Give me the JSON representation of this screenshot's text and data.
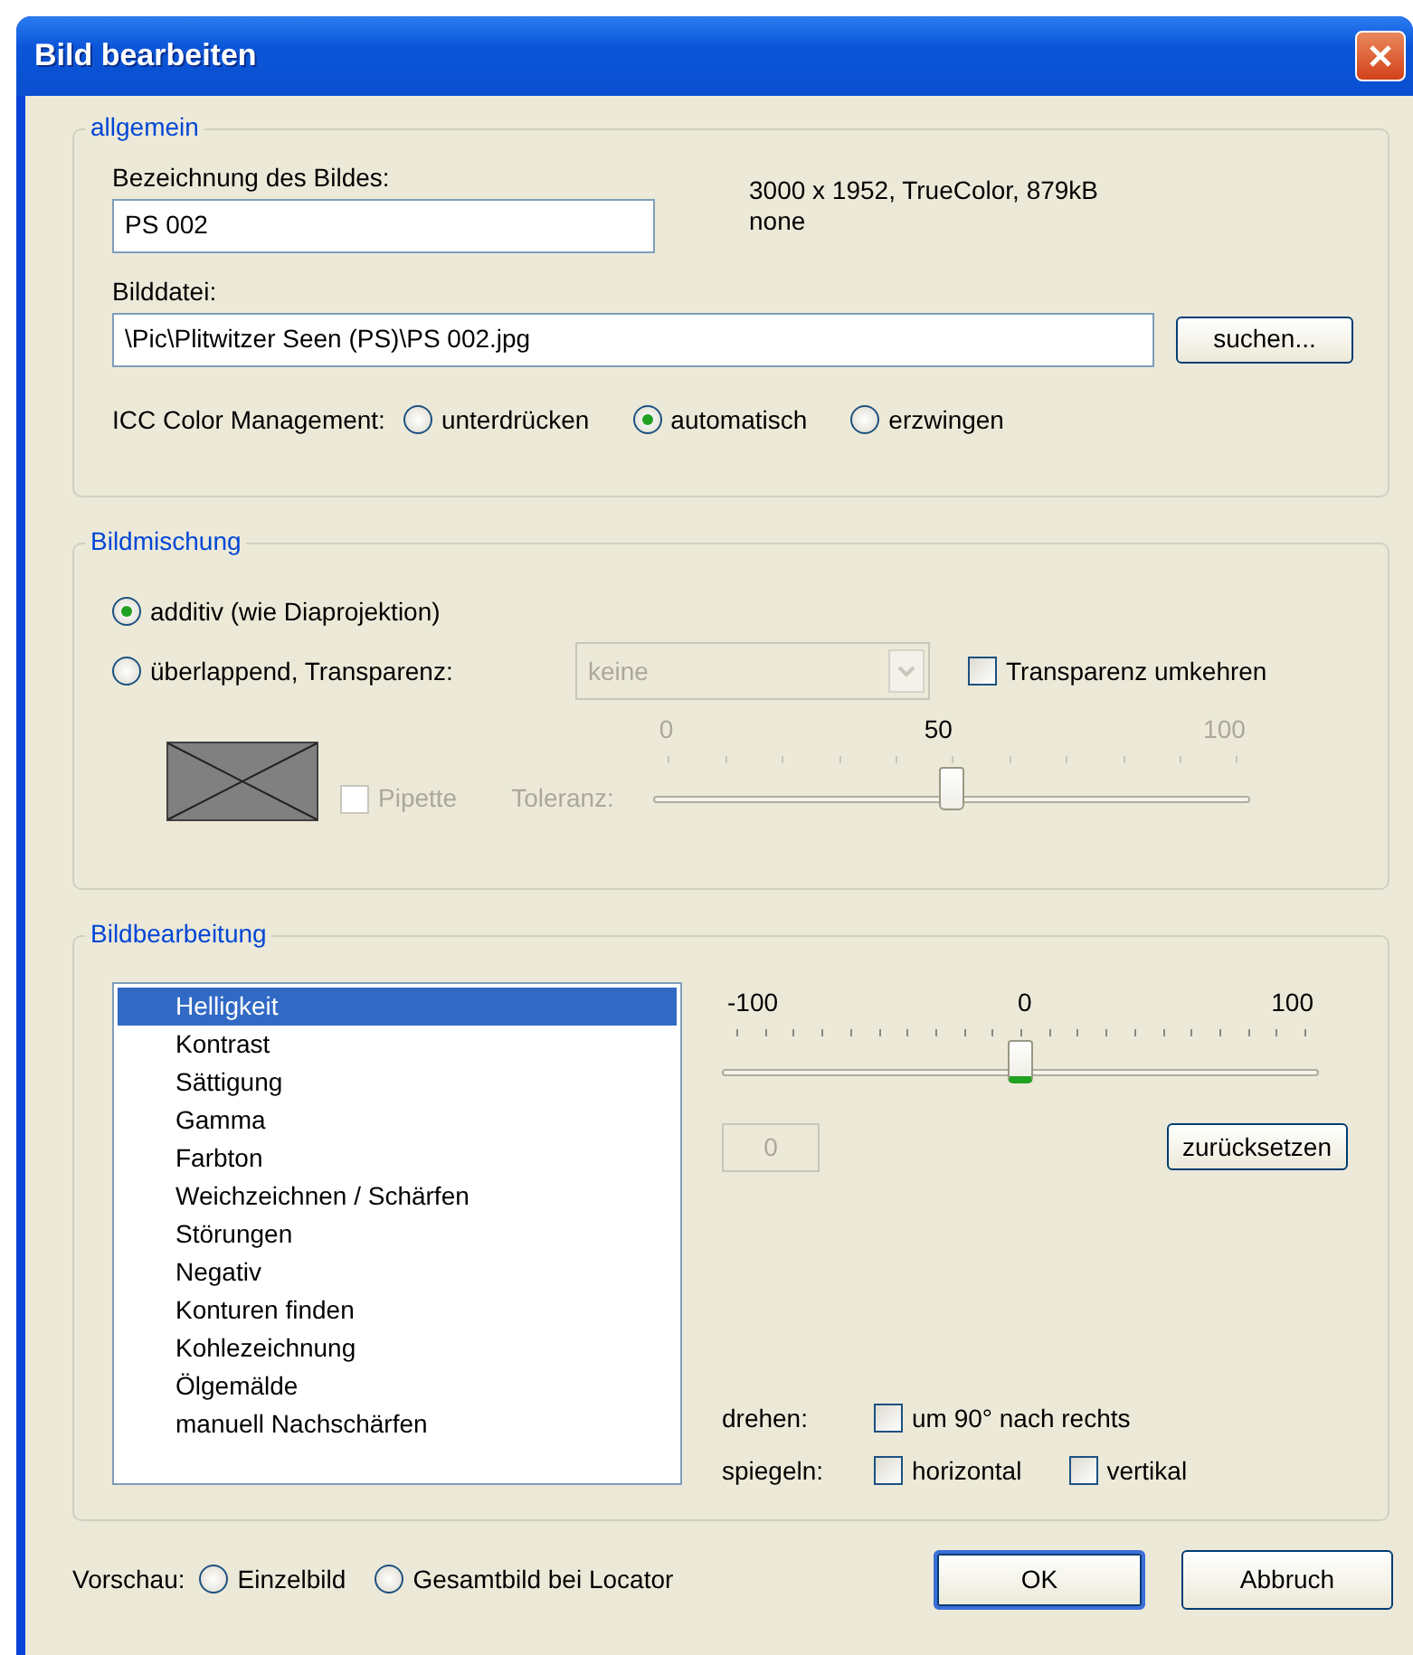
{
  "window": {
    "title": "Bild bearbeiten"
  },
  "general": {
    "legend": "allgemein",
    "name_label": "Bezeichnung des Bildes:",
    "name_value": "PS 002",
    "info": [
      "3000 x 1952, TrueColor, 879kB",
      "none"
    ],
    "file_label": "Bilddatei:",
    "file_value": "\\Pic\\Plitwitzer Seen (PS)\\PS 002.jpg",
    "browse_button": "suchen...",
    "icc_label": "ICC Color Management:",
    "icc_options": [
      {
        "label": "unterdrücken",
        "selected": false
      },
      {
        "label": "automatisch",
        "selected": true
      },
      {
        "label": "erzwingen",
        "selected": false
      }
    ]
  },
  "blending": {
    "legend": "Bildmischung",
    "modes": [
      {
        "label": "additiv (wie Diaprojektion)",
        "selected": true
      },
      {
        "label": "überlappend, Transparenz:",
        "selected": false
      }
    ],
    "transparency_select": {
      "value": "keine",
      "disabled": true
    },
    "invert": {
      "label": "Transparenz umkehren",
      "checked": false
    },
    "pipette": {
      "label": "Pipette",
      "checked": false,
      "disabled": true
    },
    "tolerance": {
      "label": "Toleranz:",
      "disabled": true,
      "min": "0",
      "value": "50",
      "max": "100",
      "level": 0.5
    }
  },
  "editing": {
    "legend": "Bildbearbeitung",
    "effects": [
      {
        "label": "Helligkeit",
        "selected": true
      },
      {
        "label": "Kontrast",
        "selected": false
      },
      {
        "label": "Sättigung",
        "selected": false
      },
      {
        "label": "Gamma",
        "selected": false
      },
      {
        "label": "Farbton",
        "selected": false
      },
      {
        "label": "Weichzeichnen / Schärfen",
        "selected": false
      },
      {
        "label": "Störungen",
        "selected": false
      },
      {
        "label": "Negativ",
        "selected": false
      },
      {
        "label": "Konturen finden",
        "selected": false
      },
      {
        "label": "Kohlezeichnung",
        "selected": false
      },
      {
        "label": "Ölgemälde",
        "selected": false
      },
      {
        "label": "manuell Nachschärfen",
        "selected": false
      }
    ],
    "slider": {
      "min": "-100",
      "value": "0",
      "max": "100",
      "level": 0.5,
      "disabled": false
    },
    "value_field": {
      "value": "0",
      "disabled": true
    },
    "reset_button": "zurücksetzen",
    "rotate_label": "drehen:",
    "rotate": {
      "label": "um 90° nach rechts",
      "checked": false
    },
    "mirror_label": "spiegeln:",
    "mirror": [
      {
        "label": "horizontal",
        "checked": false
      },
      {
        "label": "vertikal",
        "checked": false
      }
    ]
  },
  "footer": {
    "preview_label": "Vorschau:",
    "preview_options": [
      {
        "label": "Einzelbild",
        "selected": false
      },
      {
        "label": "Gesamtbild bei Locator",
        "selected": false
      }
    ],
    "buttons": [
      {
        "label": "OK",
        "default": true
      },
      {
        "label": "Abbruch",
        "default": false
      }
    ]
  }
}
